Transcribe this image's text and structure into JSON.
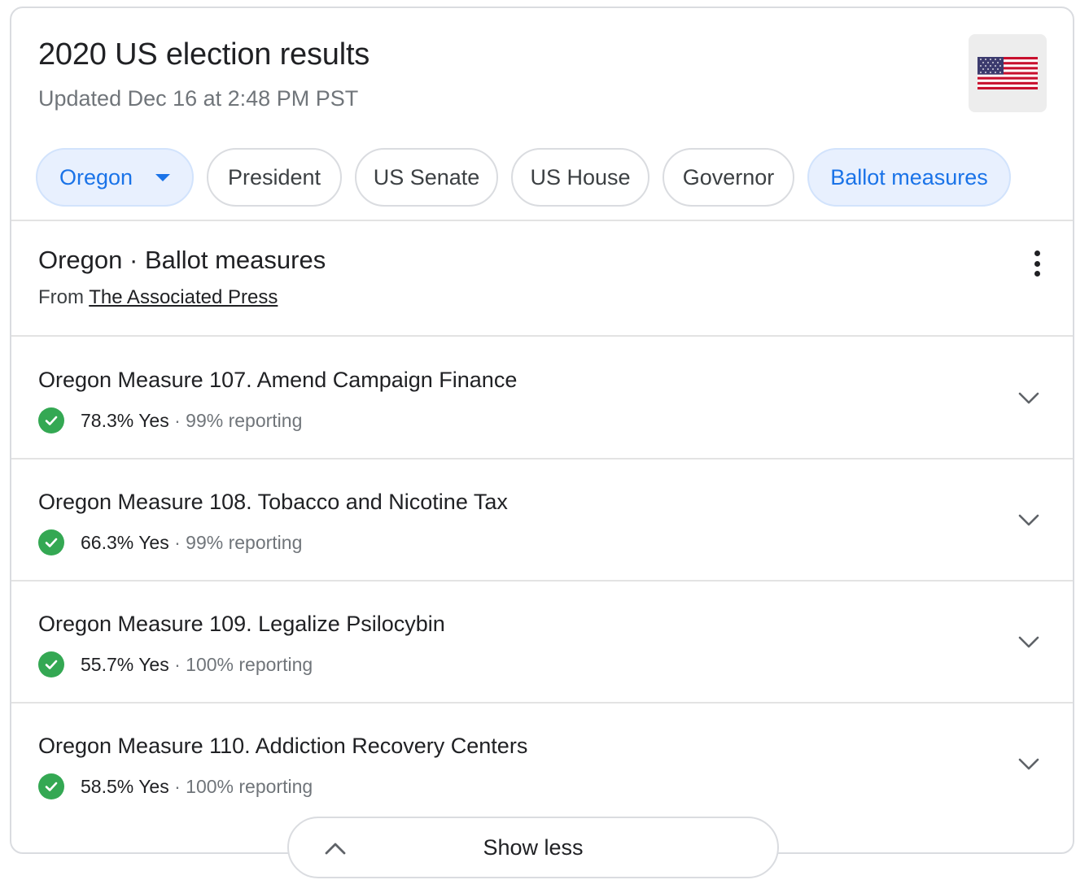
{
  "header": {
    "title": "2020 US election results",
    "updated": "Updated Dec 16 at 2:48 PM PST",
    "flag_icon": "us-flag-icon"
  },
  "chips": [
    {
      "label": "Oregon",
      "selected": true,
      "dropdown": true
    },
    {
      "label": "President",
      "selected": false
    },
    {
      "label": "US Senate",
      "selected": false
    },
    {
      "label": "US House",
      "selected": false
    },
    {
      "label": "Governor",
      "selected": false
    },
    {
      "label": "Ballot measures",
      "selected": true
    }
  ],
  "section": {
    "title": "Oregon · Ballot measures",
    "from_prefix": "From",
    "source": "The Associated Press"
  },
  "measures": [
    {
      "title": "Oregon Measure 107. Amend Campaign Finance",
      "result": "78.3% Yes",
      "reporting": "· 99% reporting"
    },
    {
      "title": "Oregon Measure 108. Tobacco and Nicotine Tax",
      "result": "66.3% Yes",
      "reporting": "· 99% reporting"
    },
    {
      "title": "Oregon Measure 109. Legalize Psilocybin",
      "result": "55.7% Yes",
      "reporting": "· 100% reporting"
    },
    {
      "title": "Oregon Measure 110. Addiction Recovery Centers",
      "result": "58.5% Yes",
      "reporting": "· 100% reporting"
    }
  ],
  "footer": {
    "show_less": "Show less"
  },
  "colors": {
    "accent": "#1a73e8",
    "chip_selected_bg": "#e8f0fe",
    "check_green": "#34a853",
    "muted": "#70757a"
  }
}
